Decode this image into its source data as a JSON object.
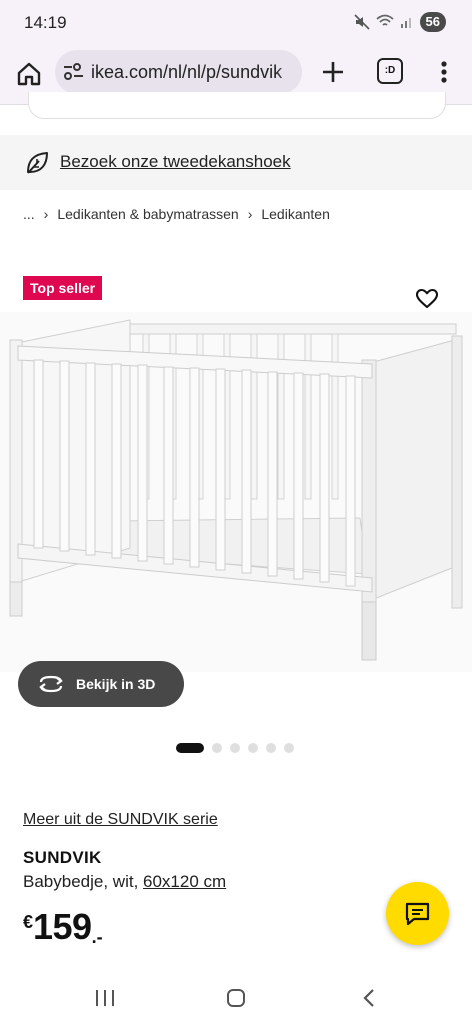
{
  "status_bar": {
    "time": "14:19",
    "battery": "56"
  },
  "browser": {
    "url": "ikea.com/nl/nl/p/sundvik",
    "tabs_label": ":D"
  },
  "second_chance": {
    "label": "Bezoek onze tweedekanshoek"
  },
  "breadcrumb": {
    "ellipsis": "...",
    "items": [
      "Ledikanten & babymatrassen",
      "Ledikanten"
    ]
  },
  "product": {
    "badge": "Top seller",
    "view_3d_label": "Bekijk in 3D",
    "gallery": {
      "image_count": 6,
      "active_index": 0
    },
    "series_link": "Meer uit de SUNDVIK serie",
    "name": "SUNDVIK",
    "description": "Babybedje, wit, ",
    "size": "60x120 cm",
    "price": {
      "currency": "€",
      "amount": "159",
      "decimals": ".-"
    }
  },
  "colors": {
    "badge": "#e00751",
    "chat_button": "#ffdb00",
    "dark_button": "#484848"
  },
  "icons": [
    "home-icon",
    "site-settings-icon",
    "plus-icon",
    "menu-icon",
    "leaf-icon",
    "heart-icon",
    "rotate-3d-icon",
    "chat-icon"
  ]
}
